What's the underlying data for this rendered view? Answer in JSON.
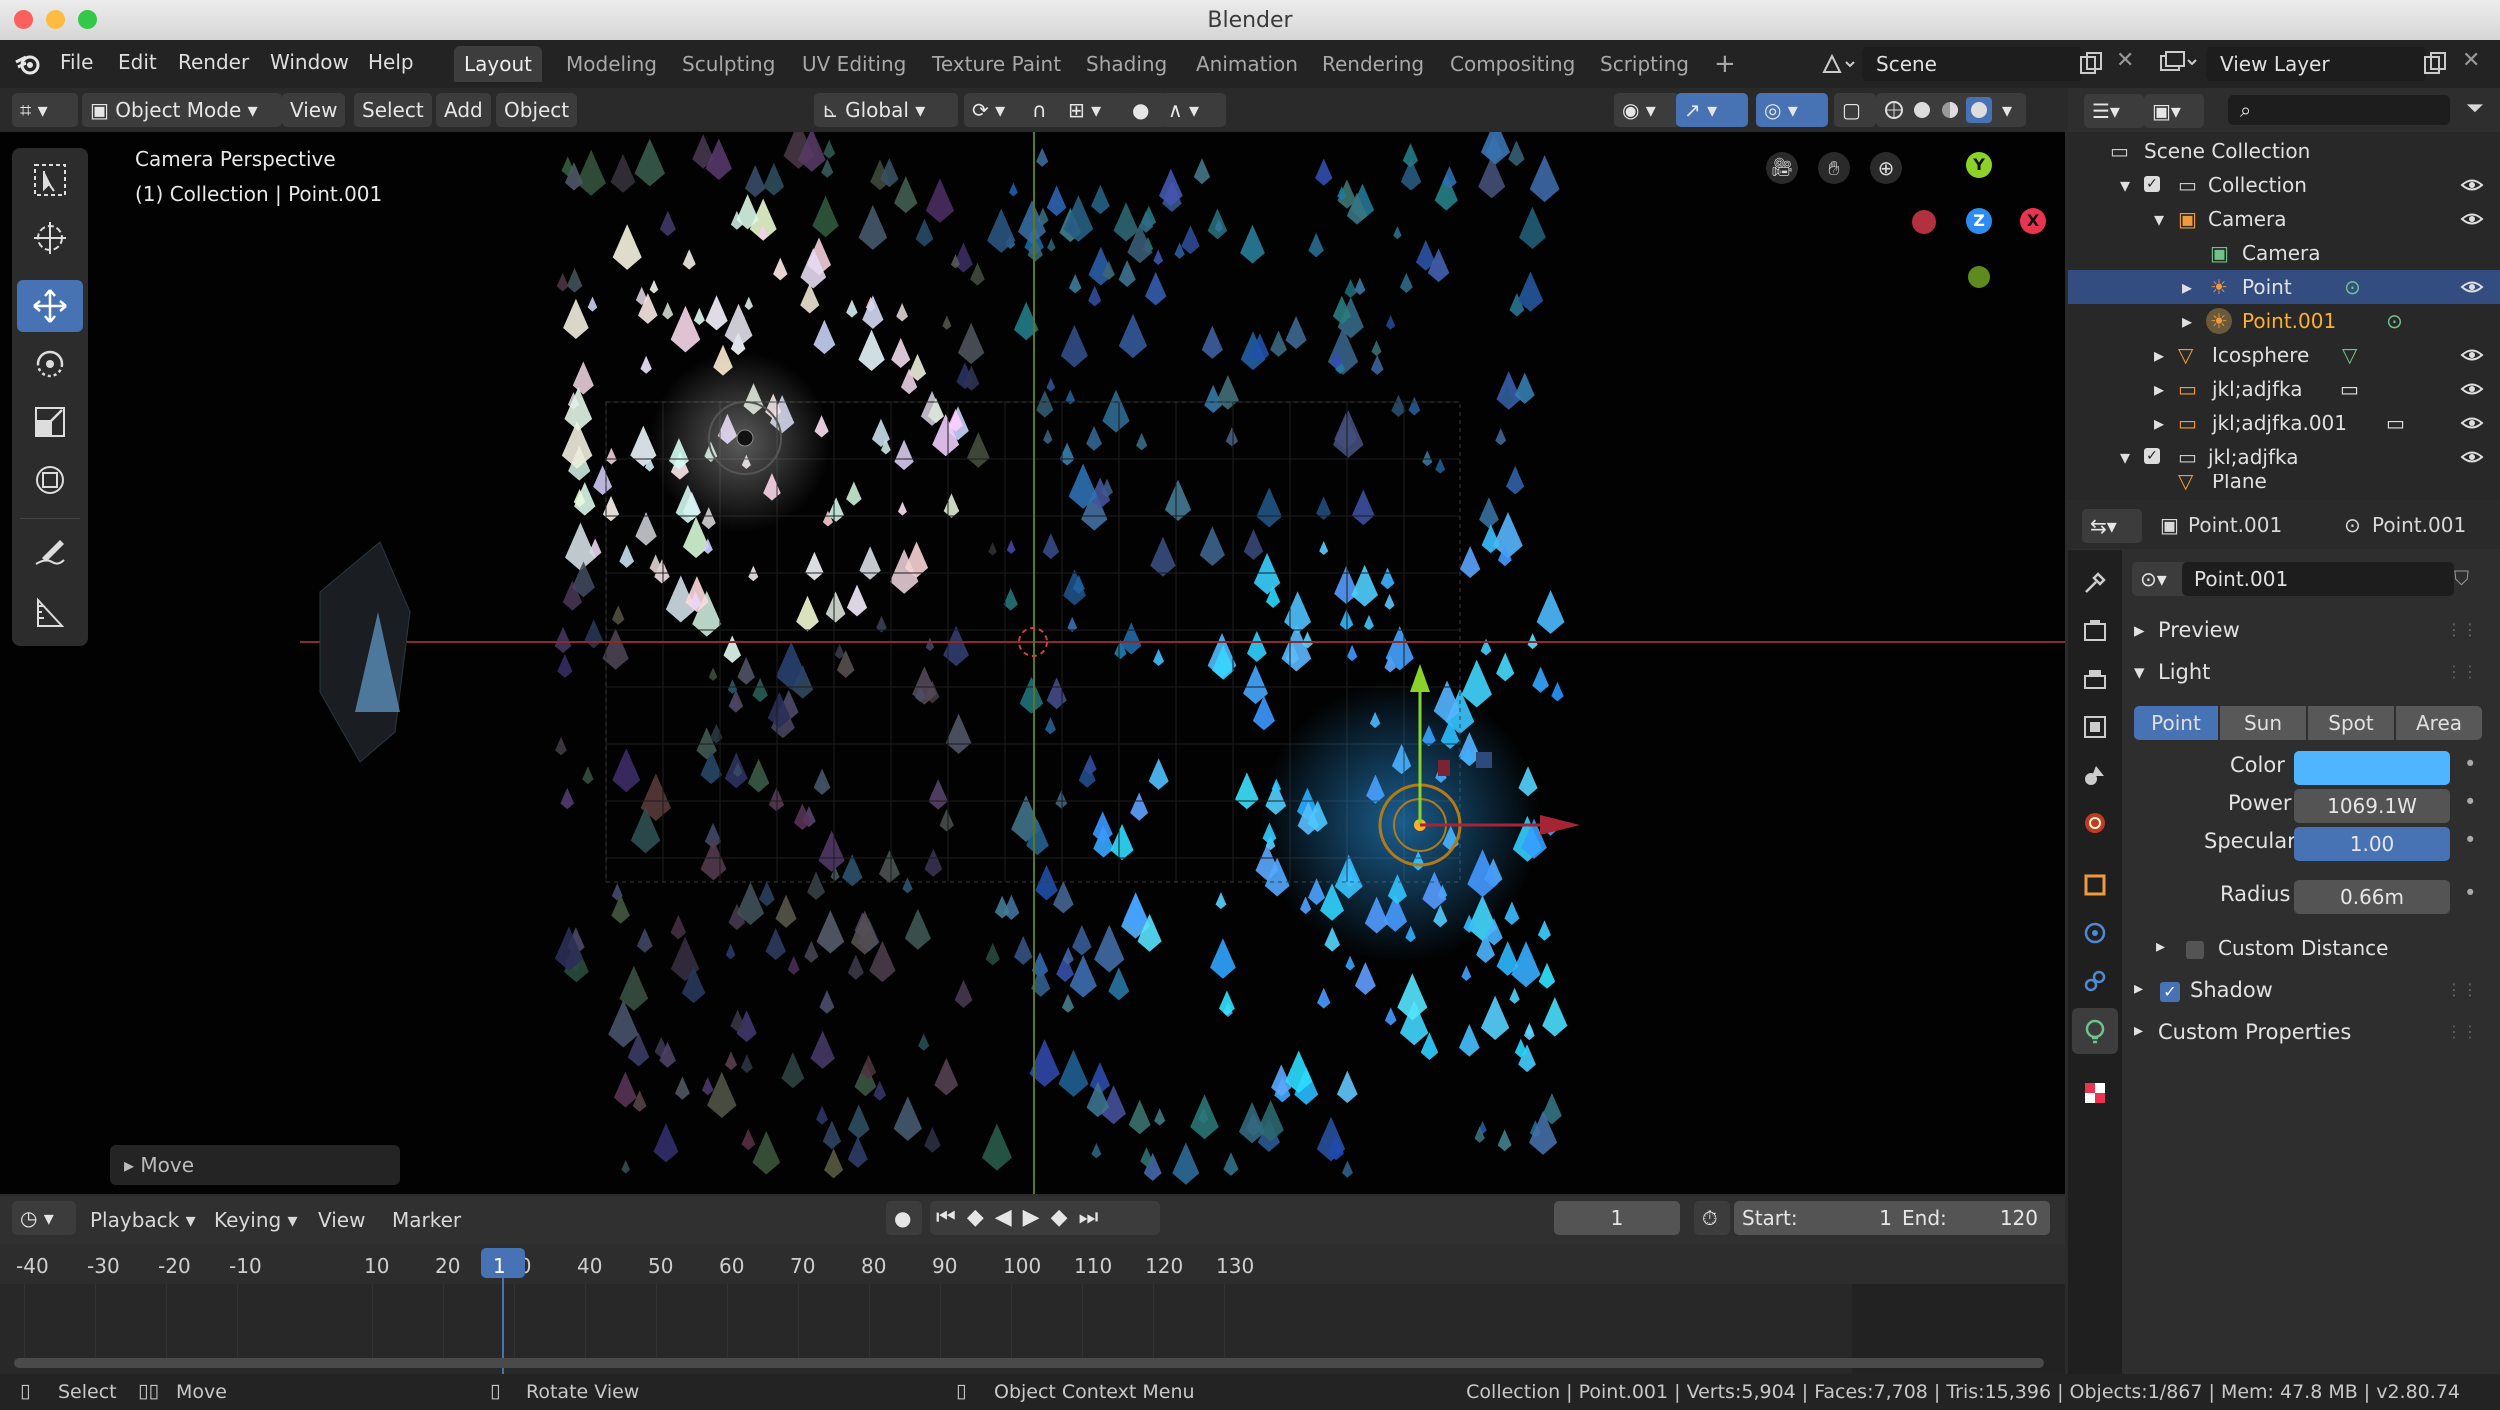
{
  "window": {
    "title": "Blender"
  },
  "menu": [
    "File",
    "Edit",
    "Render",
    "Window",
    "Help"
  ],
  "workspaces": [
    "Layout",
    "Modeling",
    "Sculpting",
    "UV Editing",
    "Texture Paint",
    "Shading",
    "Animation",
    "Rendering",
    "Compositing",
    "Scripting"
  ],
  "scene": "Scene",
  "view_layer": "View Layer",
  "viewport_header": {
    "mode": "Object Mode",
    "view": "View",
    "select": "Select",
    "add": "Add",
    "object": "Object",
    "orientation": "Global"
  },
  "viewport": {
    "perspective": "Camera Perspective",
    "context": "(1) Collection | Point.001",
    "last_op": "Move"
  },
  "gizmo_axes": {
    "y": "Y",
    "z": "Z",
    "x": "X"
  },
  "outliner": {
    "root": "Scene Collection",
    "items": [
      "Collection",
      "Camera",
      "Camera",
      "Point",
      "Point.001",
      "Icosphere",
      "jkl;adjfka",
      "jkl;adjfka.001",
      "jkl;adjfka",
      "Plane"
    ]
  },
  "properties": {
    "header_object": "Point.001",
    "header_data": "Point.001",
    "datablock": "Point.001",
    "preview_label": "Preview",
    "light_label": "Light",
    "light_types": [
      "Point",
      "Sun",
      "Spot",
      "Area"
    ],
    "selected_type": "Point",
    "color_label": "Color",
    "color_value": "#4fb5ff",
    "power_label": "Power",
    "power": "1069.1W",
    "specular_label": "Specular",
    "specular": "1.00",
    "specular_fraction": 1.0,
    "radius_label": "Radius",
    "radius": "0.66m",
    "custom_distance": "Custom Distance",
    "shadow": "Shadow",
    "custom_props": "Custom Properties"
  },
  "timeline": {
    "playback": "Playback",
    "keying": "Keying",
    "view": "View",
    "marker": "Marker",
    "current_frame": "1",
    "start_label": "Start:",
    "start": "1",
    "end_label": "End:",
    "end": "120",
    "ticks": [
      "-40",
      "-30",
      "-20",
      "-10",
      "1",
      "10",
      "20",
      "30",
      "40",
      "50",
      "60",
      "70",
      "80",
      "90",
      "100",
      "110",
      "120",
      "130"
    ]
  },
  "status": {
    "select": "Select",
    "move": "Move",
    "rotate": "Rotate View",
    "context_menu": "Object Context Menu",
    "stats": "Collection | Point.001 | Verts:5,904 | Faces:7,708 | Tris:15,396 | Objects:1/867 | Mem: 47.8 MB | v2.80.74"
  },
  "colors": {
    "accent": "#4772b3",
    "selected_row": "#334d80",
    "active_text": "#ffaf29",
    "x_axis": "#e8344f",
    "y_axis": "#8bd22a",
    "z_axis": "#2c8cf0"
  }
}
